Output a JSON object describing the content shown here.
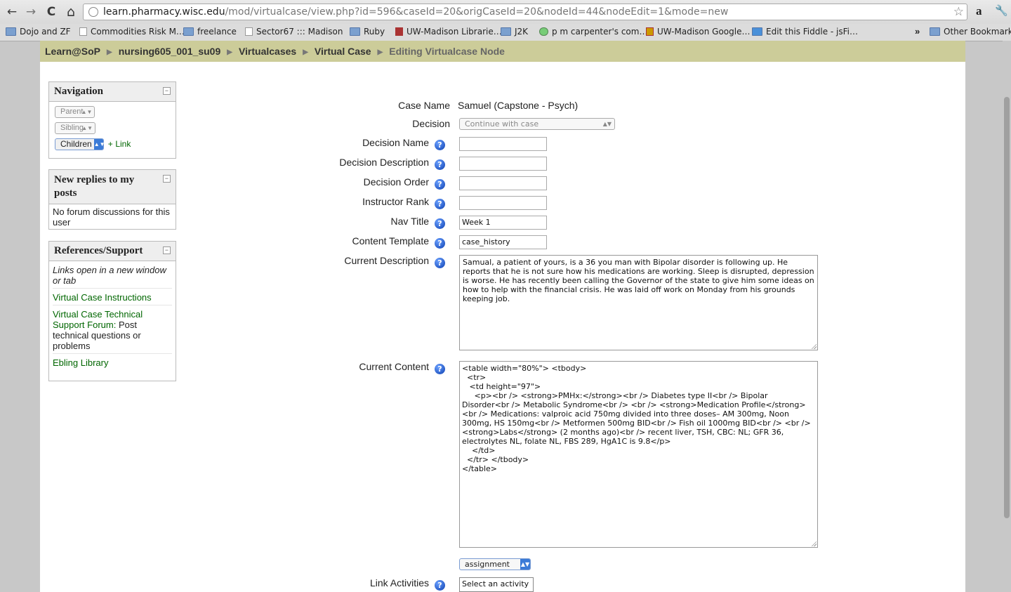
{
  "browser": {
    "url_host": "learn.pharmacy.wisc.edu",
    "url_path": "/mod/virtualcase/view.php?id=596&caseId=20&origCaseId=20&nodeId=44&nodeEdit=1&mode=new",
    "back": "←",
    "forward": "→",
    "reload": "C",
    "home": "⌂",
    "star": "☆",
    "amazon": "a",
    "wrench": "🔧"
  },
  "bookmarks": {
    "items": [
      {
        "label": "Dojo and ZF",
        "icon": "folder"
      },
      {
        "label": "Commodities Risk M…",
        "icon": "page"
      },
      {
        "label": "freelance",
        "icon": "folder"
      },
      {
        "label": "Sector67 ::: Madison",
        "icon": "page"
      },
      {
        "label": "Ruby",
        "icon": "folder"
      },
      {
        "label": "UW-Madison Librarie…",
        "icon": "page"
      },
      {
        "label": "J2K",
        "icon": "folder"
      },
      {
        "label": "p m carpenter's com…",
        "icon": "page"
      },
      {
        "label": "UW-Madison Google…",
        "icon": "page"
      },
      {
        "label": "Edit this Fiddle - jsFi…",
        "icon": "page"
      }
    ],
    "more": "»",
    "other": "Other Bookmarks"
  },
  "breadcrumb": {
    "items": [
      "Learn@SoP",
      "nursing605_001_su09",
      "Virtualcases",
      "Virtual Case",
      "Editing Virtualcase Node"
    ],
    "sep": "▶"
  },
  "navigation": {
    "title": "Navigation",
    "collapse": "−",
    "parent": "Parent",
    "sibling": "Sibling",
    "children": "Children",
    "plus": "+",
    "link": "Link"
  },
  "replies": {
    "title": "New replies to my posts",
    "collapse": "−",
    "body": "No forum discussions for this user"
  },
  "references": {
    "title": "References/Support",
    "collapse": "−",
    "note": "Links open in a new window or tab",
    "link1": "Virtual Case Instructions",
    "link2": "Virtual Case Technical Support Forum:",
    "link2_suffix": " Post technical questions or problems",
    "link3": "Ebling Library"
  },
  "form": {
    "case_name_label": "Case Name",
    "case_name_value": "Samuel (Capstone - Psych)",
    "decision_label": "Decision",
    "decision_value": "Continue with case",
    "decision_name_label": "Decision Name",
    "decision_name_value": "",
    "decision_desc_label": "Decision Description",
    "decision_desc_value": "",
    "decision_order_label": "Decision Order",
    "decision_order_value": "",
    "instructor_rank_label": "Instructor Rank",
    "instructor_rank_value": "",
    "nav_title_label": "Nav Title",
    "nav_title_value": "Week 1",
    "content_template_label": "Content Template",
    "content_template_value": "case_history",
    "current_desc_label": "Current Description",
    "current_desc_value": "Samual, a patient of yours, is a 36 you man with Bipolar disorder is following up. He reports that he is not sure how his medications are working. Sleep is disrupted, depression is worse. He has recently been calling the Governor of the state to give him some ideas on how to help with the financial crisis. He was laid off work on Monday from his grounds keeping job.",
    "current_content_label": "Current Content",
    "current_content_value": "<table width=\"80%\"> <tbody>\n  <tr>\n   <td height=\"97\">\n     <p><br /> <strong>PMHx:</strong><br /> Diabetes type II<br /> Bipolar Disorder<br /> Metabolic Syndrome<br /> <br /> <strong>Medication Profile</strong><br /> Medications: valproic acid 750mg divided into three doses– AM 300mg, Noon 300mg, HS 150mg<br /> Metformen 500mg BID<br /> Fish oil 1000mg BID<br /> <br /> <strong>Labs</strong> (2 months ago)<br /> recent liver, TSH, CBC: NL; GFR 36, electrolytes NL, folate NL, FBS 289, HgA1C is 9.8</p>\n    </td>\n  </tr> </tbody>\n</table>",
    "assignment_value": "assignment",
    "link_activities_label": "Link Activities",
    "link_activities_value": "Select an activity",
    "help": "?"
  }
}
